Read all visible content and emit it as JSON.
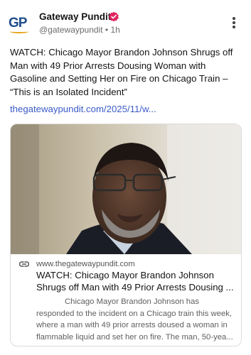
{
  "post": {
    "author_name": "Gateway Pundit",
    "avatar_initials": "GP",
    "handle": "@gatewaypundit",
    "separator": "•",
    "time": "1h",
    "text": "WATCH: Chicago Mayor Brandon Johnson Shrugs off Man with 49 Prior Arrests Dousing Woman with Gasoline and Setting Her on Fire on Chicago Train – “This is an Isolated Incident”",
    "link_text": "thegatewaypundit.com/2025/11/w...",
    "verified_color": "#e0245e",
    "link_color": "#3a5bc7"
  },
  "card": {
    "domain": "www.thegatewaypundit.com",
    "title": "WATCH: Chicago Mayor Brandon Johnson Shrugs off Man with 49 Prior Arrests Dousing ...",
    "description": "Chicago Mayor Brandon Johnson has responded to the incident on a Chicago train this week, where a man with 49 prior arrests doused a woman in flammable liquid and set her on fire. The man, 50-yea...",
    "link_icon": "link-icon",
    "image_subject": "news-photo"
  }
}
